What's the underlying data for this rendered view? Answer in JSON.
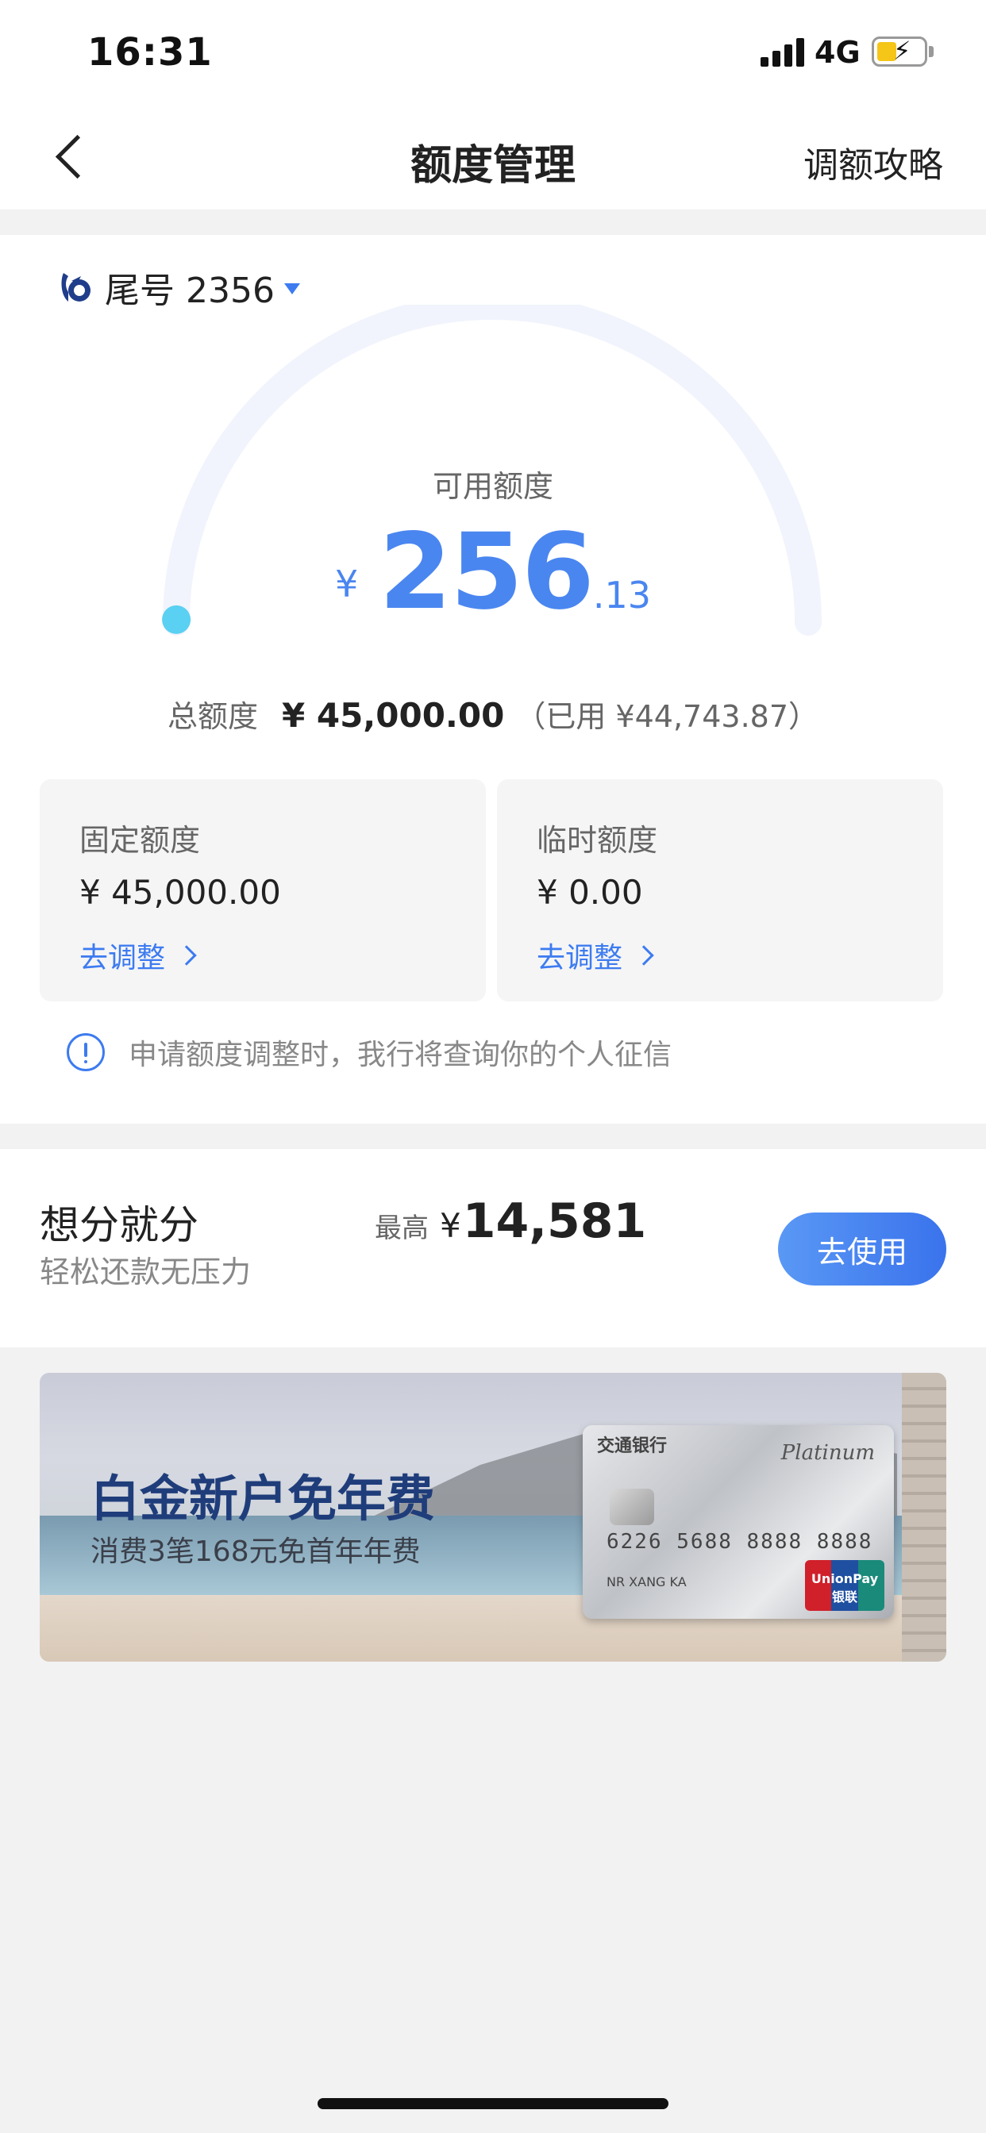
{
  "status_bar": {
    "time": "16:31",
    "network": "4G"
  },
  "nav": {
    "title": "额度管理",
    "right_action": "调额攻略"
  },
  "card": {
    "label": "尾号 2356",
    "available_label": "可用额度",
    "currency": "¥",
    "available_int": "256",
    "available_dec": ".13",
    "available_ratio": 0.0057,
    "total_label": "总额度",
    "total_value": "¥ 45,000.00",
    "used_text": "（已用 ¥44,743.87）"
  },
  "limits": [
    {
      "title": "固定额度",
      "value": "¥ 45,000.00",
      "action": "去调整"
    },
    {
      "title": "临时额度",
      "value": "¥ 0.00",
      "action": "去调整"
    }
  ],
  "notice": {
    "text": "申请额度调整时，我行将查询你的个人征信"
  },
  "installment": {
    "title": "想分就分",
    "subtitle": "轻松还款无压力",
    "max_label": "最高",
    "max_currency": "¥",
    "max_value": "14,581",
    "button": "去使用"
  },
  "banner": {
    "title": "白金新户免年费",
    "subtitle": "消费3笔168元免首年年费",
    "card_bank": "交通银行",
    "card_tier": "Platinum",
    "card_number": "6226 5688 8888 8888",
    "card_name": "NR XANG KA",
    "unionpay": "UnionPay 银联"
  },
  "colors": {
    "accent": "#3d7bf0",
    "gauge_track": "#f1f4fc",
    "gauge_dot": "#5ad0f2"
  },
  "icons": {
    "back": "chevron-left-icon",
    "logo": "bank-logo-icon",
    "dropdown": "caret-down-icon",
    "info": "info-circle-icon",
    "link": "chevron-right-icon"
  }
}
